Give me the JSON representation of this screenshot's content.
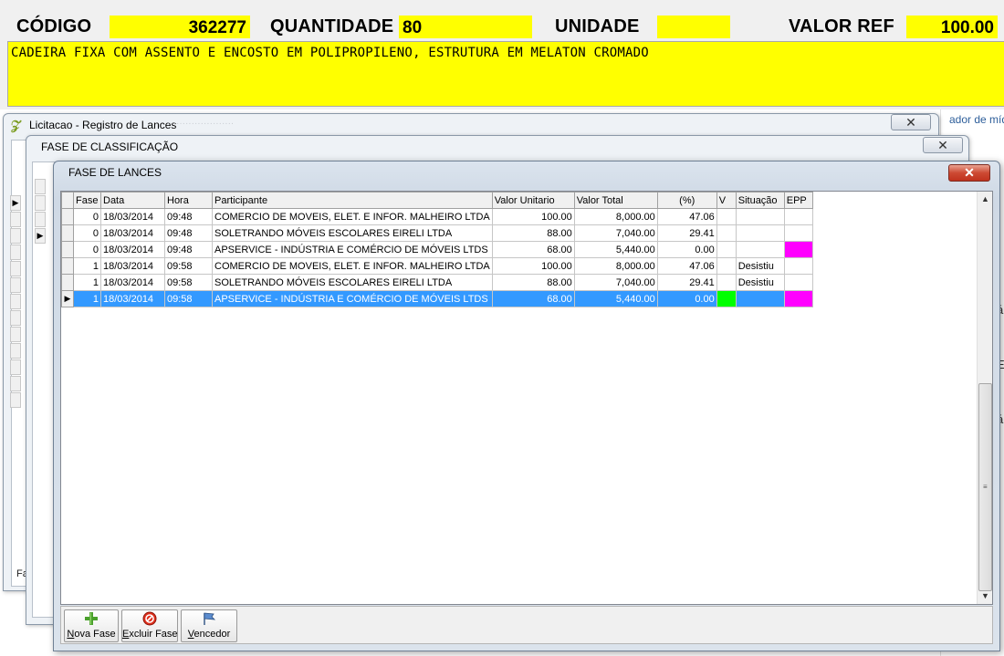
{
  "header": {
    "codigo_label": "CÓDIGO",
    "codigo_value": "362277",
    "quantidade_label": "QUANTIDADE",
    "quantidade_value": "80",
    "unidade_label": "UNIDADE",
    "unidade_value": "",
    "valor_ref_label": "VALOR REF",
    "valor_ref_value": "100.00",
    "description": "CADEIRA FIXA COM ASSENTO E ENCOSTO EM POLIPROPILENO, ESTRUTURA EM MELATON CROMADO"
  },
  "bg_window_1": {
    "title": "Licitacao - Registro de Lances",
    "close": "✕",
    "footer_text": "Fa"
  },
  "bg_window_2": {
    "title": "FASE DE CLASSIFICAÇÃO",
    "close": "✕"
  },
  "bg_app": {
    "link_text": "ador de míd",
    "chars": [
      "á",
      "E",
      "á"
    ]
  },
  "main_window": {
    "title": "FASE DE LANCES",
    "close": "✕",
    "columns": [
      "Fase",
      "Data",
      "Hora",
      "Participante",
      "Valor Unitario",
      "Valor Total",
      "(%)",
      "V",
      "Situação",
      "EPP"
    ],
    "rows": [
      {
        "fase": "0",
        "data": "18/03/2014",
        "hora": "09:48",
        "participante": "COMERCIO DE MOVEIS, ELET. E INFOR. MALHEIRO LTDA",
        "valor_unitario": "100.00",
        "valor_total": "8,000.00",
        "pct": "47.06",
        "v": "",
        "situacao": "",
        "epp": ""
      },
      {
        "fase": "0",
        "data": "18/03/2014",
        "hora": "09:48",
        "participante": "SOLETRANDO MÓVEIS ESCOLARES EIRELI LTDA",
        "valor_unitario": "88.00",
        "valor_total": "7,040.00",
        "pct": "29.41",
        "v": "",
        "situacao": "",
        "epp": ""
      },
      {
        "fase": "0",
        "data": "18/03/2014",
        "hora": "09:48",
        "participante": "APSERVICE - INDÚSTRIA E COMÉRCIO DE MÓVEIS LTDS",
        "valor_unitario": "68.00",
        "valor_total": "5,440.00",
        "pct": "0.00",
        "v": "",
        "situacao": "",
        "epp": ""
      },
      {
        "fase": "1",
        "data": "18/03/2014",
        "hora": "09:58",
        "participante": "COMERCIO DE MOVEIS, ELET. E INFOR. MALHEIRO LTDA",
        "valor_unitario": "100.00",
        "valor_total": "8,000.00",
        "pct": "47.06",
        "v": "",
        "situacao": "Desistiu",
        "epp": ""
      },
      {
        "fase": "1",
        "data": "18/03/2014",
        "hora": "09:58",
        "participante": "SOLETRANDO MÓVEIS ESCOLARES EIRELI LTDA",
        "valor_unitario": "88.00",
        "valor_total": "7,040.00",
        "pct": "29.41",
        "v": "",
        "situacao": "Desistiu",
        "epp": ""
      },
      {
        "fase": "1",
        "data": "18/03/2014",
        "hora": "09:58",
        "participante": "APSERVICE - INDÚSTRIA E COMÉRCIO DE MÓVEIS LTDS",
        "valor_unitario": "68.00",
        "valor_total": "5,440.00",
        "pct": "0.00",
        "v": "",
        "situacao": "",
        "epp": ""
      }
    ],
    "highlight": {
      "v_green_rows": [
        5
      ],
      "epp_magenta_rows": [
        2,
        5
      ],
      "selected_row": 5
    },
    "toolbar": {
      "nova_fase_prefix": "N",
      "nova_fase_rest": "ova Fase",
      "excluir_fase_prefix": "E",
      "excluir_fase_rest": "xcluir Fase",
      "vencedor_prefix": "V",
      "vencedor_rest": "encedor"
    }
  },
  "colors": {
    "header_yellow": "#ffff00",
    "selection_blue": "#3399ff",
    "v_green": "#00ff00",
    "epp_magenta": "#ff00ff"
  },
  "icons": {
    "nova_fase": "plus-icon",
    "excluir_fase": "delete-icon",
    "vencedor": "flag-icon",
    "app_logo": "app-logo-icon"
  }
}
